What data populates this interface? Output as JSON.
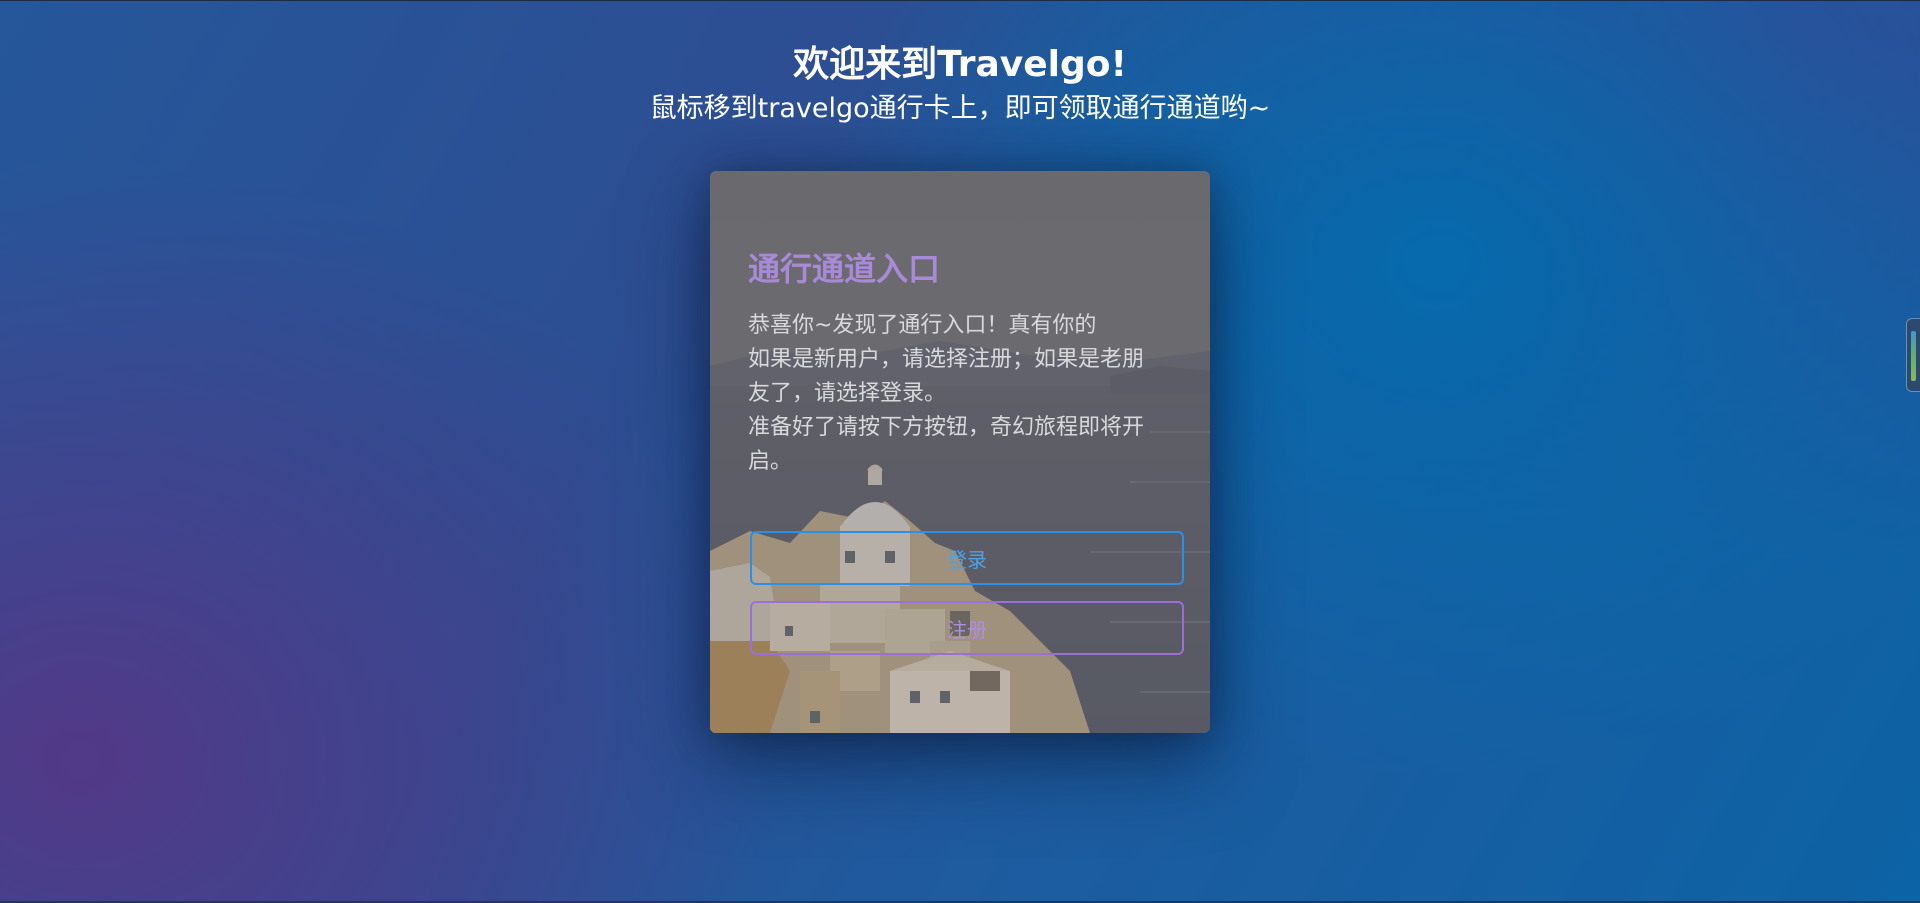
{
  "header": {
    "title": "欢迎来到Travelgo!",
    "subtitle": "鼠标移到travelgo通行卡上，即可领取通行通道哟~"
  },
  "card": {
    "title": "通行通道入口",
    "lines": [
      "恭喜你~发现了通行入口！真有你的",
      "如果是新用户，请选择注册；如果是老朋友了，请选择登录。",
      "准备好了请按下方按钮，奇幻旅程即将开启。"
    ],
    "login_label": "登录",
    "register_label": "注册"
  },
  "colors": {
    "card_title": "#a98ad8",
    "login_accent": "#2f8fe0",
    "register_accent": "#9c6fd8"
  },
  "icons": {
    "side_widget": "volume-meter-icon"
  }
}
